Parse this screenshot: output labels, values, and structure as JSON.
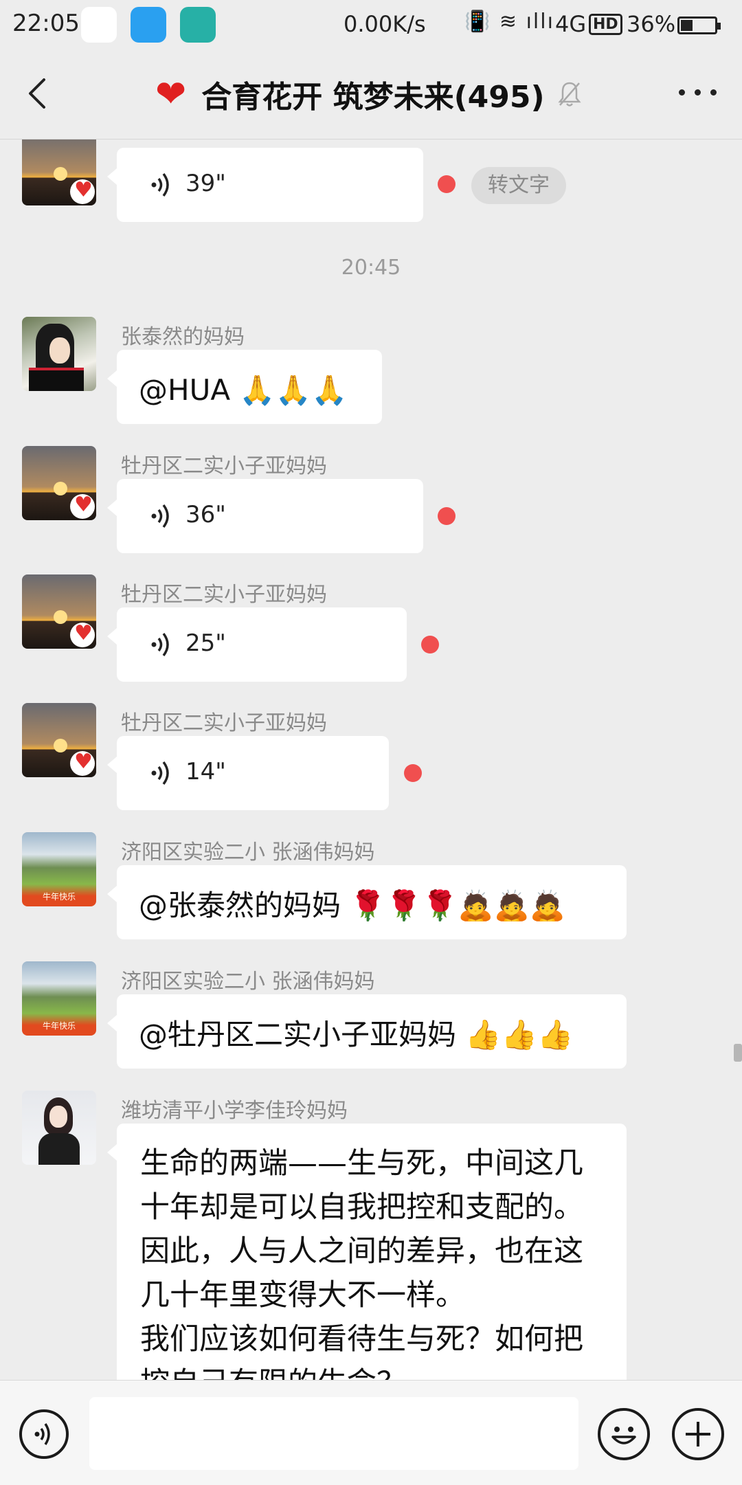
{
  "status_bar": {
    "time": "22:05",
    "speed": "0.00K/s",
    "signal_icons": "📳 ≋ ıllı",
    "network": "4G",
    "hd_label": "HD",
    "battery": "36%",
    "battery_level": 0.36
  },
  "header": {
    "heart": "❤",
    "title": "合育花开 筑梦未来(495)"
  },
  "chat": {
    "messages": [
      {
        "type": "voice",
        "duration": "39\"",
        "convert_label": "转文字"
      },
      {
        "type": "timestamp",
        "text": "20:45"
      },
      {
        "type": "text",
        "sender": "张泰然的妈妈",
        "text": "@HUA 🙏🙏🙏"
      },
      {
        "type": "voice",
        "sender": "牡丹区二实小子亚妈妈",
        "duration": "36\""
      },
      {
        "type": "voice",
        "sender": "牡丹区二实小子亚妈妈",
        "duration": "25\""
      },
      {
        "type": "voice",
        "sender": "牡丹区二实小子亚妈妈",
        "duration": "14\""
      },
      {
        "type": "text",
        "sender": "济阳区实验二小    张涵伟妈妈",
        "text": "@张泰然的妈妈 🌹🌹🌹🙇🙇🙇",
        "avatar_text": "牛年快乐"
      },
      {
        "type": "text",
        "sender": "济阳区实验二小    张涵伟妈妈",
        "text": "@牡丹区二实小子亚妈妈 👍👍👍",
        "avatar_text": "牛年快乐"
      },
      {
        "type": "text",
        "sender": "潍坊清平小学李佳玲妈妈",
        "lines": [
          "生命的两端——生与死，中间这几",
          "十年却是可以自我把控和支配的。",
          "因此，人与人之间的差异，也在这",
          "几十年里变得大不一样。",
          "我们应该如何看待生与死？如何把",
          "控自己有限的生命？"
        ]
      }
    ]
  },
  "input": {
    "placeholder": ""
  }
}
